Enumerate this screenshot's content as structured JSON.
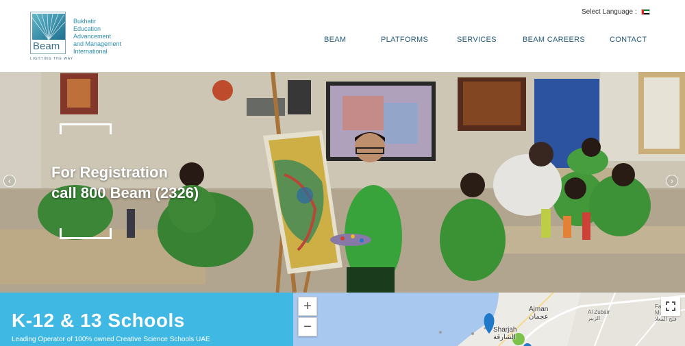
{
  "header": {
    "logo": {
      "word": "Beam",
      "tagline": "LIGHTING THE WAY",
      "org_lines": [
        "Bukhatir",
        "Education",
        "Advancement",
        "and Management",
        "International"
      ]
    },
    "language": {
      "label": "Select Language :",
      "flag": "uae-flag-icon"
    },
    "nav": [
      "BEAM",
      "PLATFORMS",
      "SERVICES",
      "BEAM CAREERS",
      "CONTACT"
    ]
  },
  "hero": {
    "line1": "For Registration",
    "line2": "call 800 Beam (2326)",
    "prev_icon": "chevron-left-icon",
    "next_icon": "chevron-right-icon"
  },
  "schools": {
    "title": "K-12 & 13 Schools",
    "subtitle": "Leading Operator of 100% owned Creative Science Schools UAE"
  },
  "map": {
    "zoom_in": "+",
    "zoom_out": "−",
    "labels": {
      "ajman_en": "Ajman",
      "ajman_ar": "عجمان",
      "alzubair_en": "Al Zubair",
      "alzubair_ar": "الزبير",
      "falaj_en_1": "Falaj Al",
      "falaj_en_2": "Mualla",
      "falaj_ar": "فلج المعلا",
      "sharjah_en": "Sharjah",
      "sharjah_ar": "الشارقة"
    }
  },
  "colors": {
    "nav_text": "#215a7a",
    "schools_bg": "#3fb8e3",
    "map_water": "#a9c8f0",
    "pin_blue": "#1f78c8",
    "pin_green": "#7cc24a"
  }
}
